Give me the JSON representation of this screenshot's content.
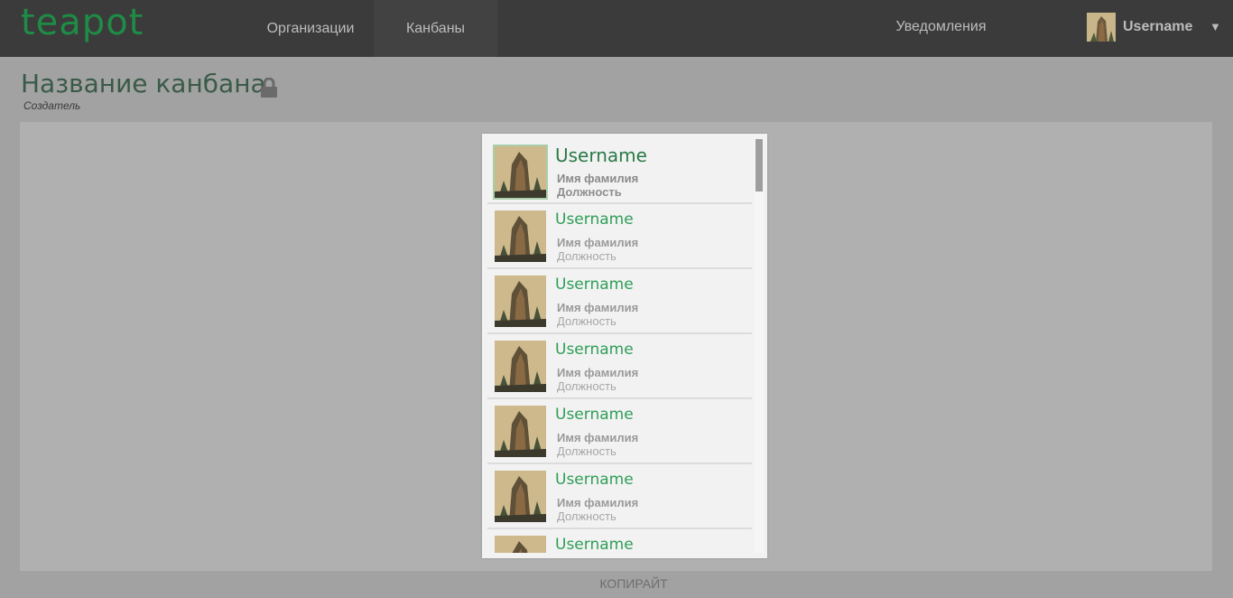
{
  "app": {
    "logo": "teapot"
  },
  "nav": {
    "organizations": "Организации",
    "kanbans": "Канбаны",
    "notifications": "Уведомления"
  },
  "user": {
    "name": "Username",
    "caret": "▼"
  },
  "page": {
    "title": "Название канбана",
    "creator": "Создатель"
  },
  "users_list": [
    {
      "username": "Username",
      "full_name": "Имя фамилия",
      "position": "Должность",
      "selected": true
    },
    {
      "username": "Username",
      "full_name": "Имя фамилия",
      "position": "Должность"
    },
    {
      "username": "Username",
      "full_name": "Имя фамилия",
      "position": "Должность"
    },
    {
      "username": "Username",
      "full_name": "Имя фамилия",
      "position": "Должность"
    },
    {
      "username": "Username",
      "full_name": "Имя фамилия",
      "position": "Должность"
    },
    {
      "username": "Username",
      "full_name": "Имя фамилия",
      "position": "Должность"
    },
    {
      "username": "Username"
    }
  ],
  "footer": {
    "copyright": "КОПИРАЙТ"
  },
  "colors": {
    "brand": "#1f8c46",
    "username_green": "#2f9e58",
    "topbar": "#3b3b3b"
  }
}
